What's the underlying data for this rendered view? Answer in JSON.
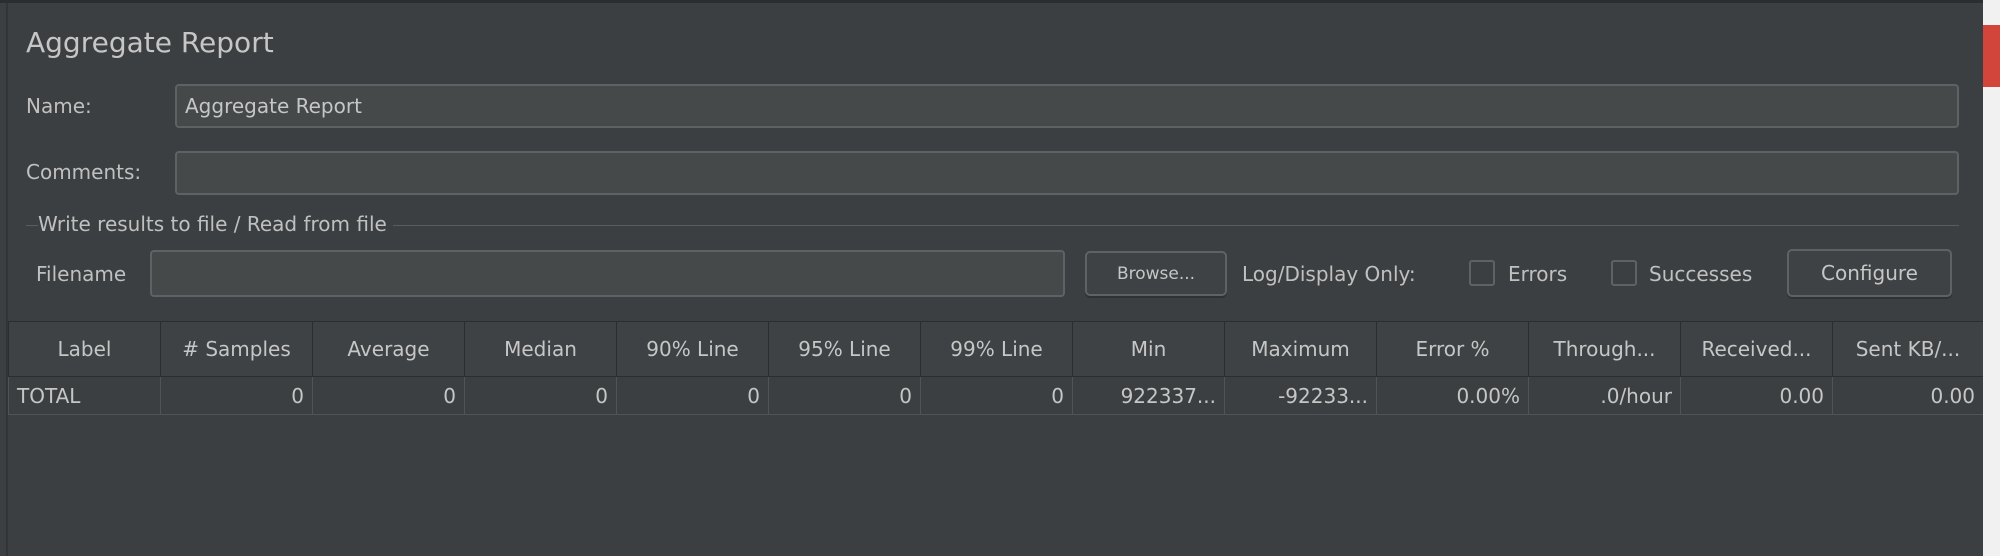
{
  "panel": {
    "title": "Aggregate Report",
    "name_label": "Name:",
    "name_value": "Aggregate Report",
    "comments_label": "Comments:",
    "comments_value": "",
    "file_section_label": "Write results to file / Read from file",
    "filename_label": "Filename",
    "filename_value": "",
    "browse_label": "Browse...",
    "log_display_label": "Log/Display Only:",
    "errors_label": "Errors",
    "errors_checked": false,
    "successes_label": "Successes",
    "successes_checked": false,
    "configure_label": "Configure"
  },
  "table": {
    "columns": [
      "Label",
      "# Samples",
      "Average",
      "Median",
      "90% Line",
      "95% Line",
      "99% Line",
      "Min",
      "Maximum",
      "Error %",
      "Through...",
      "Received...",
      "Sent KB/..."
    ],
    "rows": [
      [
        "TOTAL",
        "0",
        "0",
        "0",
        "0",
        "0",
        "0",
        "922337...",
        "-92233...",
        "0.00%",
        ".0/hour",
        "0.00",
        "0.00"
      ]
    ]
  },
  "colors": {
    "background": "#3c3f41",
    "accent_red": "#d2453a"
  }
}
